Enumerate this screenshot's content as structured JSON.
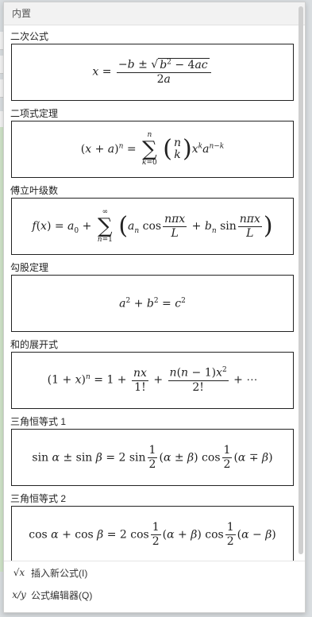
{
  "panel": {
    "header": "内置"
  },
  "formulas": [
    {
      "title": "二次公式"
    },
    {
      "title": "二项式定理"
    },
    {
      "title": "傅立叶级数"
    },
    {
      "title": "勾股定理"
    },
    {
      "title": "和的展开式"
    },
    {
      "title": "三角恒等式 1"
    },
    {
      "title": "三角恒等式 2"
    }
  ],
  "footer": {
    "insert_label": "插入新公式(I)",
    "editor_label": "公式编辑器(Q)",
    "insert_icon": "radical-icon",
    "editor_icon": "formula-editor-icon"
  }
}
